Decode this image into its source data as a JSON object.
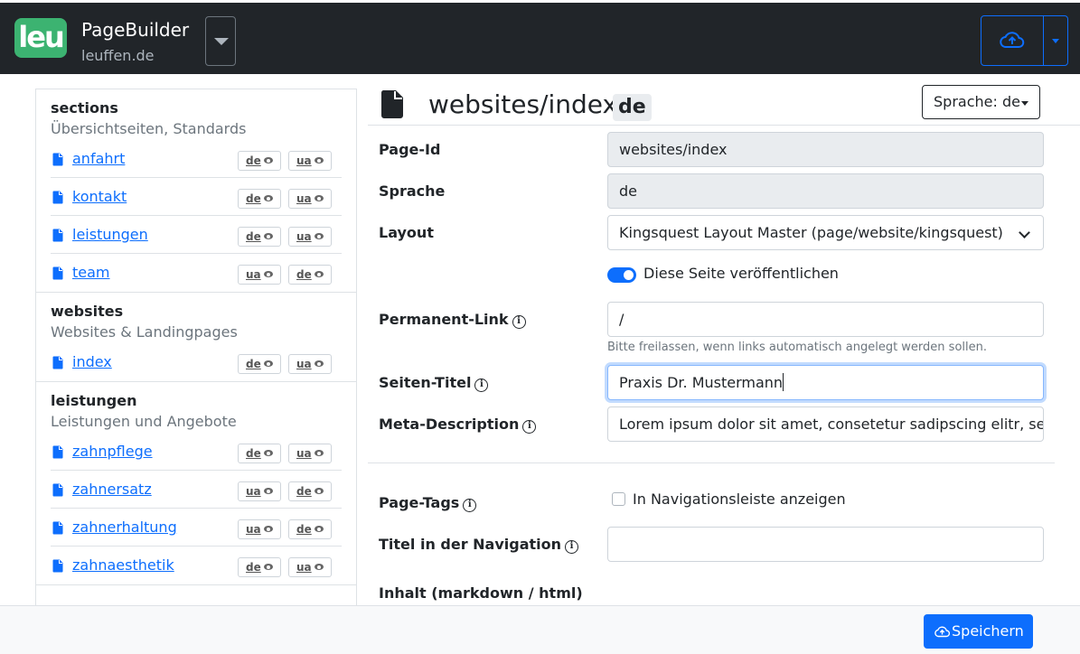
{
  "app": {
    "logo_text": "leu",
    "title": "PageBuilder",
    "site": "leuffen.de"
  },
  "sidebar": {
    "groups": [
      {
        "title": "sections",
        "description": "Übersichtseiten, Standards",
        "items": [
          {
            "label": "anfahrt",
            "badges": [
              "de",
              "ua"
            ]
          },
          {
            "label": "kontakt",
            "badges": [
              "de",
              "ua"
            ]
          },
          {
            "label": "leistungen",
            "badges": [
              "de",
              "ua"
            ]
          },
          {
            "label": "team",
            "badges": [
              "ua",
              "de"
            ]
          }
        ]
      },
      {
        "title": "websites",
        "description": "Websites & Landingpages",
        "items": [
          {
            "label": "index",
            "badges": [
              "de",
              "ua"
            ]
          }
        ]
      },
      {
        "title": "leistungen",
        "description": "Leistungen und Angebote",
        "items": [
          {
            "label": "zahnpflege",
            "badges": [
              "de",
              "ua"
            ]
          },
          {
            "label": "zahnersatz",
            "badges": [
              "ua",
              "de"
            ]
          },
          {
            "label": "zahnerhaltung",
            "badges": [
              "ua",
              "de"
            ]
          },
          {
            "label": "zahnaesthetik",
            "badges": [
              "de",
              "ua"
            ]
          }
        ]
      }
    ]
  },
  "main": {
    "heading": "websites/index",
    "lang_badge": "de",
    "lang_select": "Sprache: de",
    "page_id_label": "Page-Id",
    "page_id_value": "websites/index",
    "sprache_label": "Sprache",
    "sprache_value": "de",
    "layout_label": "Layout",
    "layout_value": "Kingsquest Layout Master (page/website/kingsquest)",
    "publish_label": "Diese Seite veröffentlichen",
    "permalink_label": "Permanent-Link",
    "permalink_value": "/",
    "permalink_help": "Bitte freilassen, wenn links automatisch angelegt werden sollen.",
    "title_label": "Seiten-Titel",
    "title_value": "Praxis Dr. Mustermann",
    "meta_label": "Meta-Description",
    "meta_value": "Lorem ipsum dolor sit amet, consetetur sadipscing elitr, sed diam",
    "tags_label": "Page-Tags",
    "nav_checkbox_label": "In Navigationsleiste anzeigen",
    "nav_title_label": "Titel in der Navigation",
    "nav_title_value": "",
    "content_label": "Inhalt (markdown / html)"
  },
  "footer": {
    "save_label": "Speichern"
  },
  "colors": {
    "topbar": "#212529",
    "primary": "#0d6efd",
    "logo": "#3cb371"
  },
  "icons": {
    "upload": "cloud-upload-icon",
    "document": "file-icon",
    "info": "info-icon",
    "eye": "eye-icon"
  }
}
